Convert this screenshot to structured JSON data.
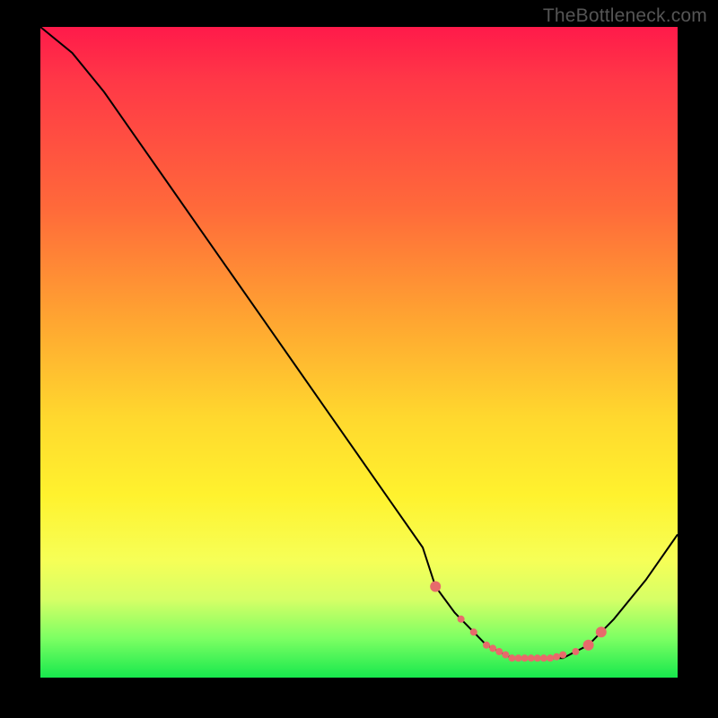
{
  "attribution": "TheBottleneck.com",
  "chart_data": {
    "type": "line",
    "title": "",
    "xlabel": "",
    "ylabel": "",
    "xlim": [
      0,
      100
    ],
    "ylim": [
      0,
      100
    ],
    "x": [
      0,
      5,
      10,
      15,
      20,
      25,
      30,
      35,
      40,
      45,
      50,
      55,
      60,
      62,
      65,
      68,
      70,
      72,
      74,
      76,
      78,
      80,
      82,
      84,
      86,
      88,
      90,
      95,
      100
    ],
    "values": [
      100,
      96,
      90,
      83,
      76,
      69,
      62,
      55,
      48,
      41,
      34,
      27,
      20,
      14,
      10,
      7,
      5,
      4,
      3,
      3,
      3,
      3,
      3,
      4,
      5,
      7,
      9,
      15,
      22
    ],
    "markers": {
      "x": [
        62,
        66,
        68,
        70,
        71,
        72,
        73,
        74,
        75,
        76,
        77,
        78,
        79,
        80,
        81,
        82,
        84,
        86,
        88
      ],
      "y": [
        14,
        9,
        7,
        5,
        4.5,
        4,
        3.5,
        3,
        3,
        3,
        3,
        3,
        3,
        3,
        3.2,
        3.5,
        4,
        5,
        7
      ],
      "color": "#e76b6b",
      "size_large_idx": [
        0,
        17,
        18
      ]
    },
    "curve_color": "#000000"
  }
}
